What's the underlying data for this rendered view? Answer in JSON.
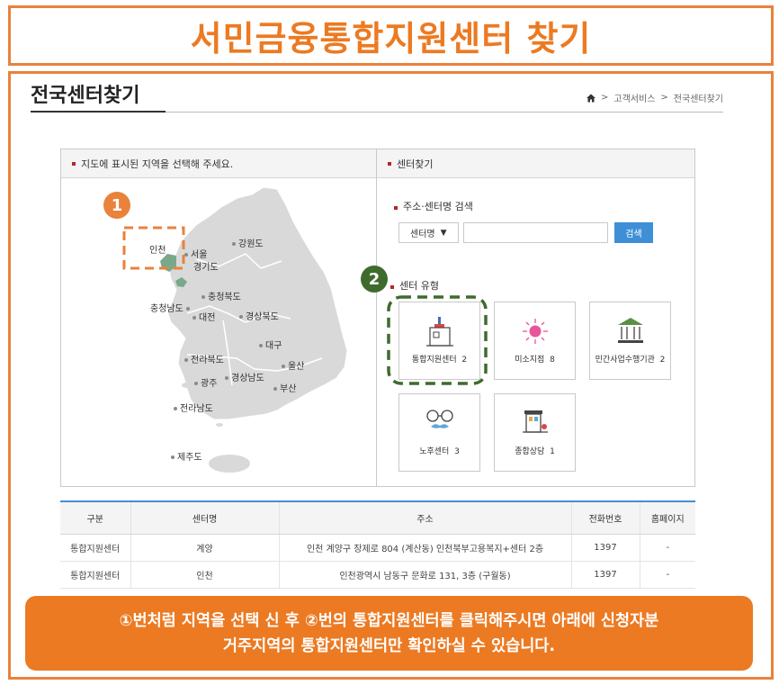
{
  "banner": {
    "title": "서민금융통합지원센터 찾기"
  },
  "page": {
    "title": "전국센터찾기",
    "breadcrumb": {
      "sep1": ">",
      "item1": "고객서비스",
      "sep2": ">",
      "item2": "전국센터찾기"
    }
  },
  "map_panel": {
    "heading": "지도에 표시된 지역을 선택해 주세요.",
    "regions": [
      "인천",
      "서울",
      "경기도",
      "강원도",
      "충청북도",
      "충청남도",
      "대전",
      "경상북도",
      "대구",
      "전라북도",
      "울산",
      "경상남도",
      "광주",
      "부산",
      "전라남도",
      "제주도"
    ]
  },
  "search_panel": {
    "heading": "센터찾기",
    "search_label": "주소·센터명 검색",
    "select_value": "센터명",
    "select_arrow": "▼",
    "input_value": "",
    "search_button": "검색",
    "type_label": "센터 유형",
    "types": [
      {
        "label": "통합지원센터",
        "count": "2"
      },
      {
        "label": "미소지점",
        "count": "8"
      },
      {
        "label": "민간사업수행기관",
        "count": "2"
      },
      {
        "label": "노후센터",
        "count": "3"
      },
      {
        "label": "종합상담",
        "count": "1"
      }
    ]
  },
  "markers": {
    "one": "1",
    "two": "2"
  },
  "table": {
    "headers": [
      "구분",
      "센터명",
      "주소",
      "전화번호",
      "홈페이지"
    ],
    "rows": [
      [
        "통합지원센터",
        "계양",
        "인천 계양구 장제로 804 (계산동) 인천북부고용복지+센터 2층",
        "1397",
        "-"
      ],
      [
        "통합지원센터",
        "인천",
        "인천광역시 남동구 문화로 131, 3층 (구월동)",
        "1397",
        "-"
      ]
    ]
  },
  "note": {
    "line1": "①번처럼 지역을 선택 신 후 ②번의 통합지원센터를 클릭해주시면 아래에 신청자분",
    "line2": "거주지역의 통합지원센터만 확인하실 수 있습니다."
  },
  "colors": {
    "accent": "#ec7a22",
    "frame": "#e9823b",
    "button": "#3f8fd6",
    "marker_one": "#e9823b",
    "marker_two": "#3f6b2f"
  },
  "icons": [
    "home-icon",
    "building-icon",
    "sun-icon",
    "bank-icon",
    "glasses-icon",
    "shop-icon"
  ]
}
